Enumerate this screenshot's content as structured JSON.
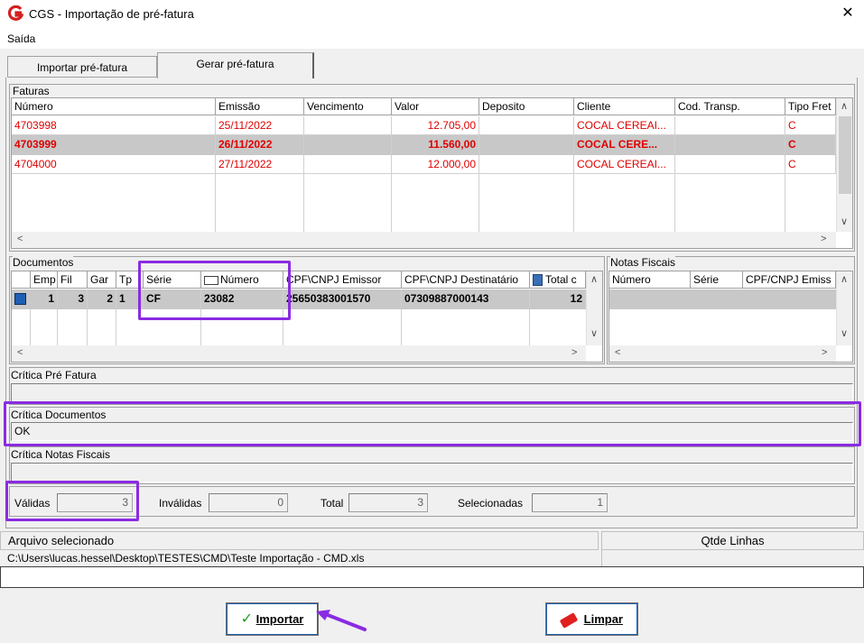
{
  "window": {
    "title": "CGS - Importação de pré-fatura",
    "close": "✕"
  },
  "menu": {
    "saida": "Saída"
  },
  "tabs": {
    "importar": "Importar pré-fatura",
    "gerar": "Gerar pré-fatura"
  },
  "faturas": {
    "label": "Faturas",
    "headers": [
      "Número",
      "Emissão",
      "Vencimento",
      "Valor",
      "Deposito",
      "Cliente",
      "Cod. Transp.",
      "Tipo Fret"
    ],
    "rows": [
      [
        "4703998",
        "25/11/2022",
        "",
        "12.705,00",
        "",
        "COCAL CEREAI...",
        "",
        "C"
      ],
      [
        "4703999",
        "26/11/2022",
        "",
        "11.560,00",
        "",
        "COCAL CERE...",
        "",
        "C"
      ],
      [
        "4704000",
        "27/11/2022",
        "",
        "12.000,00",
        "",
        "COCAL CEREAI...",
        "",
        "C"
      ]
    ]
  },
  "documentos": {
    "label": "Documentos",
    "headers": [
      "Emp",
      "Fil",
      "Gar",
      "Tp",
      "Série",
      "Número",
      "CPF\\CNPJ Emissor",
      "CPF\\CNPJ Destinatário",
      "Total c"
    ],
    "row": [
      "1",
      "3",
      "2",
      "1",
      "CF",
      "23082",
      "25650383001570",
      "07309887000143",
      "12"
    ]
  },
  "notas": {
    "label": "Notas Fiscais",
    "headers": [
      "Número",
      "Série",
      "CPF/CNPJ Emiss"
    ]
  },
  "critica": {
    "pre_fatura": "Crítica Pré Fatura",
    "documentos": "Crítica Documentos",
    "documentos_value": "OK",
    "notas": "Crítica Notas Fiscais"
  },
  "counts": {
    "validas_label": "Válidas",
    "validas": "3",
    "invalidas_label": "Inválidas",
    "invalidas": "0",
    "total_label": "Total",
    "total": "3",
    "selecionadas_label": "Selecionadas",
    "selecionadas": "1"
  },
  "arquivo": {
    "header": "Arquivo selecionado",
    "linhas_header": "Qtde Linhas",
    "path": "C:\\Users\\lucas.hessel\\Desktop\\TESTES\\CMD\\Teste Importação - CMD.xls"
  },
  "buttons": {
    "importar": "Importar",
    "limpar": "Limpar"
  },
  "colors": {
    "accent_highlight": "#8a2be2",
    "error_red": "#e00000"
  },
  "icons": [
    "app-logo-icon",
    "close-icon",
    "check-icon",
    "eraser-icon",
    "checkbox-icon",
    "calc-icon",
    "card-icon"
  ]
}
